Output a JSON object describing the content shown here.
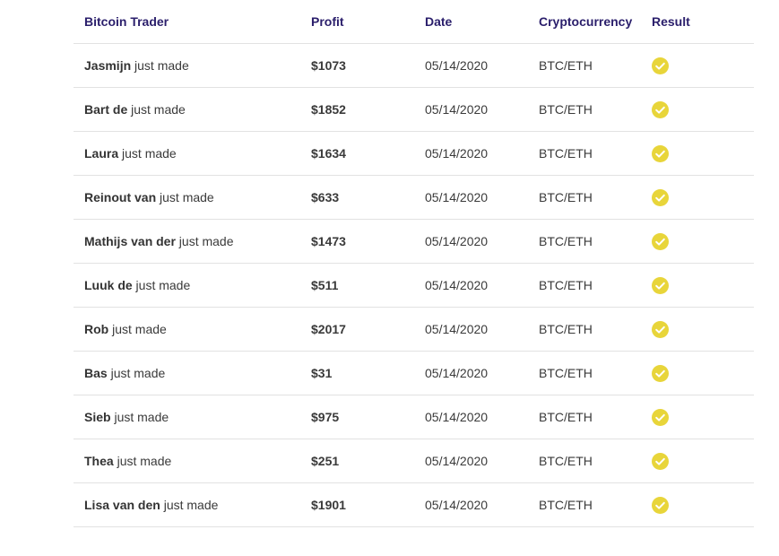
{
  "colors": {
    "header_text": "#2a1e6b",
    "accent_check": "#e8d53a"
  },
  "table": {
    "headers": {
      "trader": "Bitcoin Trader",
      "profit": "Profit",
      "date": "Date",
      "crypto": "Cryptocurrency",
      "result": "Result"
    },
    "rows": [
      {
        "name": "Jasmijn",
        "suffix": " just made",
        "profit": "$1073",
        "date": "05/14/2020",
        "crypto": "BTC/ETH",
        "result_icon": "check-circle-icon"
      },
      {
        "name": "Bart de",
        "suffix": " just made",
        "profit": "$1852",
        "date": "05/14/2020",
        "crypto": "BTC/ETH",
        "result_icon": "check-circle-icon"
      },
      {
        "name": "Laura",
        "suffix": " just made",
        "profit": "$1634",
        "date": "05/14/2020",
        "crypto": "BTC/ETH",
        "result_icon": "check-circle-icon"
      },
      {
        "name": "Reinout van",
        "suffix": " just made",
        "profit": "$633",
        "date": "05/14/2020",
        "crypto": "BTC/ETH",
        "result_icon": "check-circle-icon"
      },
      {
        "name": "Mathijs van der",
        "suffix": " just made",
        "profit": "$1473",
        "date": "05/14/2020",
        "crypto": "BTC/ETH",
        "result_icon": "check-circle-icon"
      },
      {
        "name": "Luuk de",
        "suffix": " just made",
        "profit": "$511",
        "date": "05/14/2020",
        "crypto": "BTC/ETH",
        "result_icon": "check-circle-icon"
      },
      {
        "name": "Rob",
        "suffix": " just made",
        "profit": "$2017",
        "date": "05/14/2020",
        "crypto": "BTC/ETH",
        "result_icon": "check-circle-icon"
      },
      {
        "name": "Bas",
        "suffix": " just made",
        "profit": "$31",
        "date": "05/14/2020",
        "crypto": "BTC/ETH",
        "result_icon": "check-circle-icon"
      },
      {
        "name": "Sieb",
        "suffix": " just made",
        "profit": "$975",
        "date": "05/14/2020",
        "crypto": "BTC/ETH",
        "result_icon": "check-circle-icon"
      },
      {
        "name": "Thea",
        "suffix": " just made",
        "profit": "$251",
        "date": "05/14/2020",
        "crypto": "BTC/ETH",
        "result_icon": "check-circle-icon"
      },
      {
        "name": "Lisa van den",
        "suffix": " just made",
        "profit": "$1901",
        "date": "05/14/2020",
        "crypto": "BTC/ETH",
        "result_icon": "check-circle-icon"
      }
    ]
  }
}
